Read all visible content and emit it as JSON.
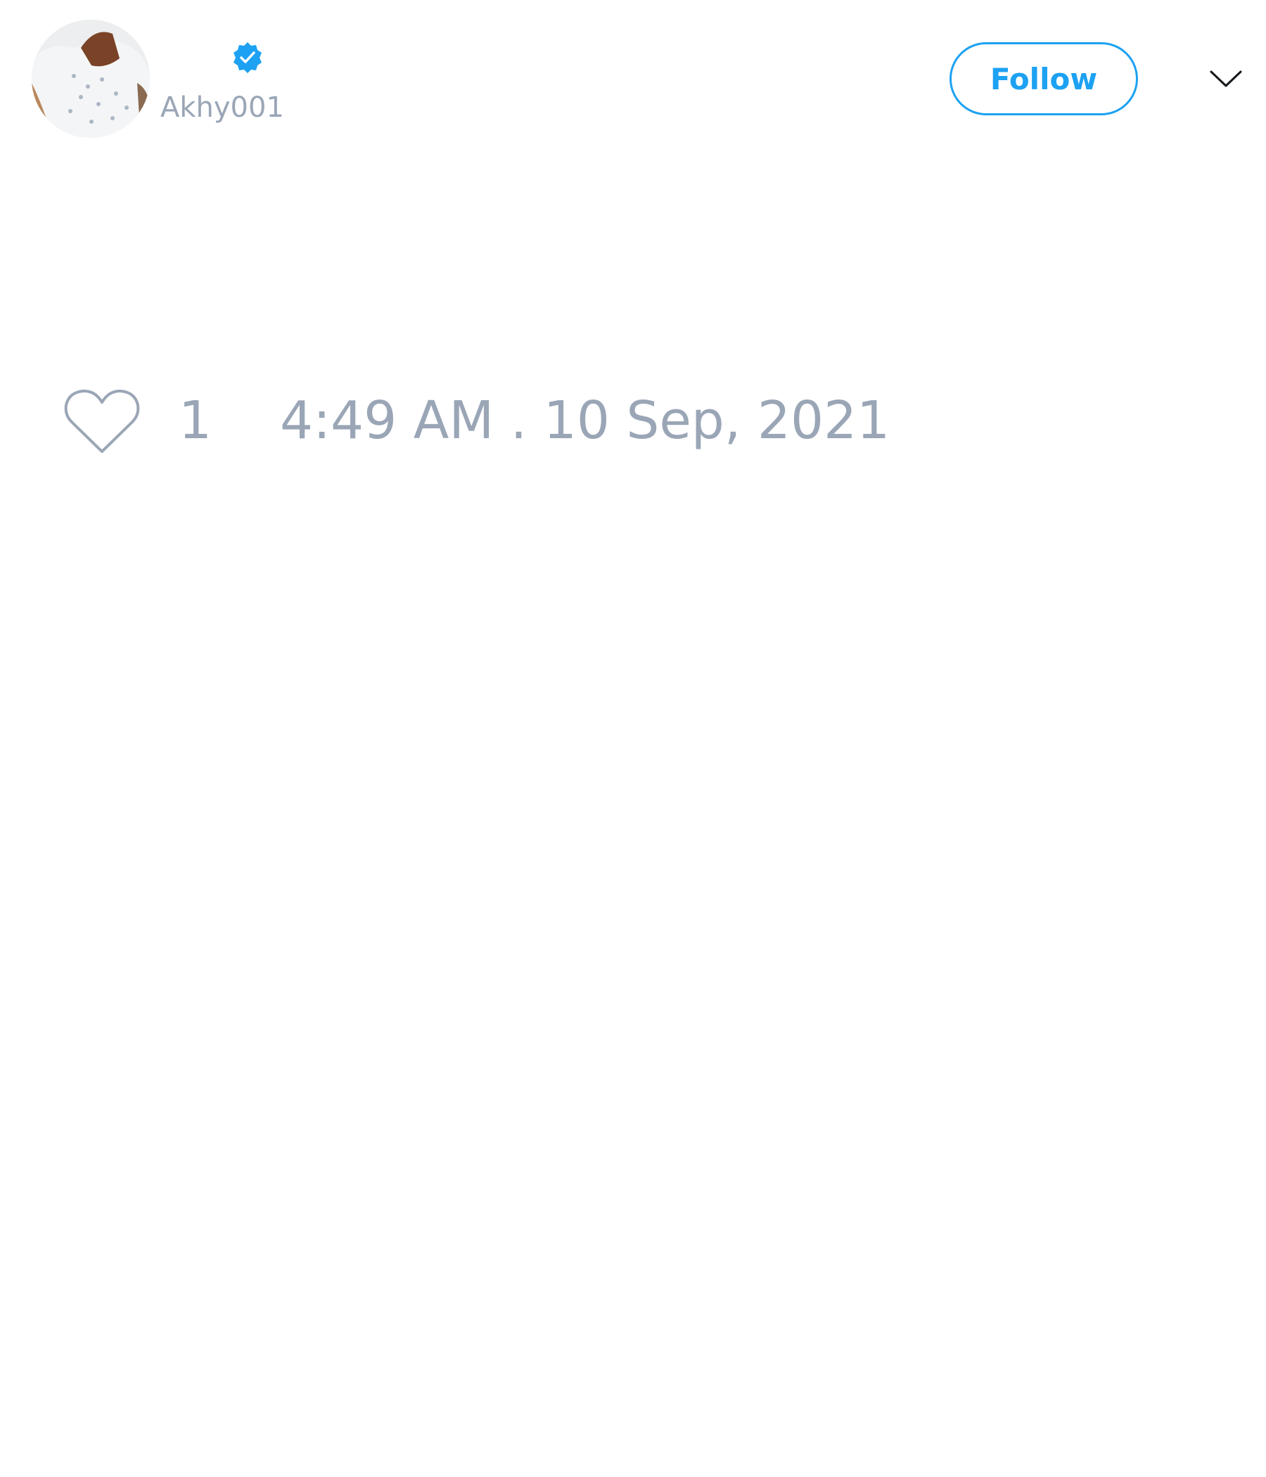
{
  "author": {
    "handle": "Akhy001",
    "verified": true,
    "avatar_icon": "user-avatar-photo"
  },
  "header": {
    "follow_label": "Follow",
    "menu_icon": "chevron-down-icon"
  },
  "footer": {
    "like_icon": "heart-outline-icon",
    "like_count": "1",
    "timestamp": "4:49 AM . 10 Sep, 2021"
  },
  "colors": {
    "accent": "#1da1f2",
    "muted_text": "#9aa6b6",
    "background": "#ffffff"
  }
}
